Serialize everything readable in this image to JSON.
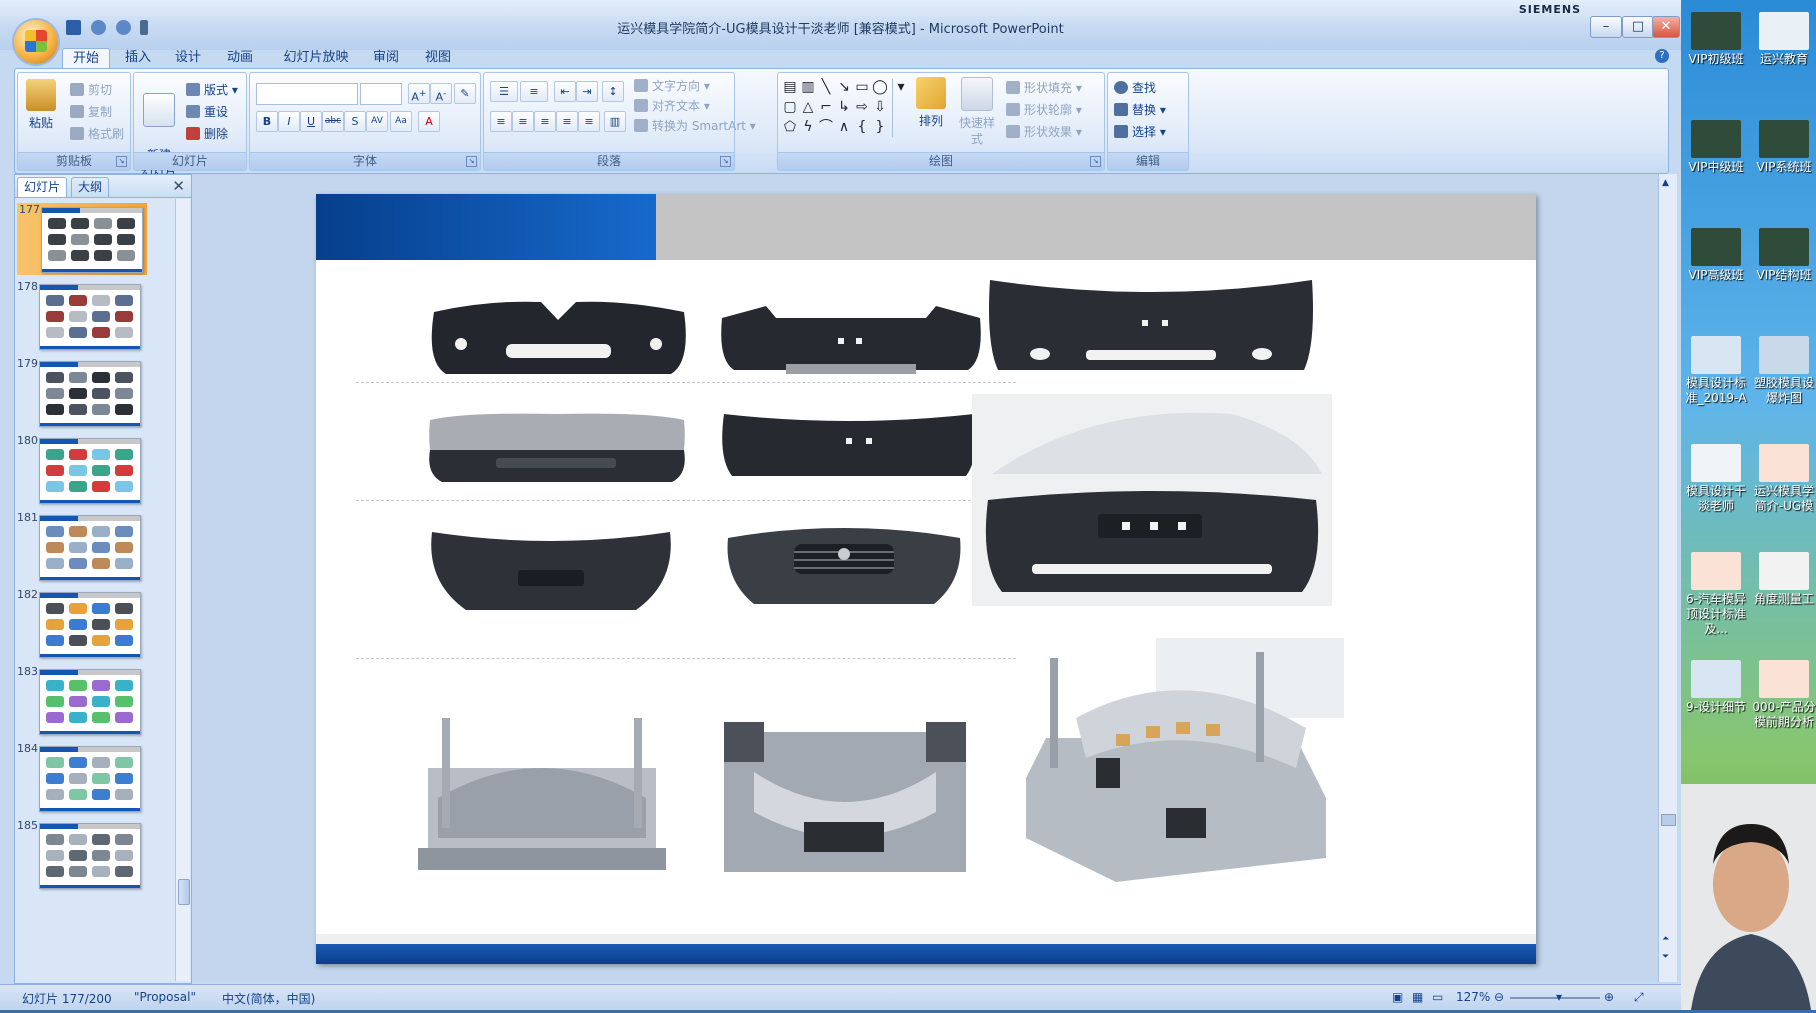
{
  "window": {
    "title": "运兴模具学院简介-UG模具设计干淡老师 [兼容模式] - Microsoft PowerPoint",
    "brand": "SIEMENS"
  },
  "tabs": [
    "开始",
    "插入",
    "设计",
    "动画",
    "幻灯片放映",
    "审阅",
    "视图"
  ],
  "ribbon": {
    "clipboard": {
      "label": "剪贴板",
      "paste": "粘贴",
      "cut": "剪切",
      "copy": "复制",
      "format_painter": "格式刷"
    },
    "slides": {
      "label": "幻灯片",
      "new_slide": "新建\n幻灯片",
      "layout": "版式",
      "reset": "重设",
      "delete": "删除"
    },
    "font": {
      "label": "字体"
    },
    "paragraph": {
      "label": "段落",
      "text_direction": "文字方向",
      "align_text": "对齐文本",
      "convert_smartart": "转换为 SmartArt"
    },
    "drawing": {
      "label": "绘图",
      "arrange": "排列",
      "quick_styles": "快速样式",
      "shape_fill": "形状填充",
      "shape_outline": "形状轮廓",
      "shape_effects": "形状效果"
    },
    "editing": {
      "label": "编辑",
      "find": "查找",
      "replace": "替换",
      "select": "选择"
    }
  },
  "panel": {
    "tab_slides": "幻灯片",
    "tab_outline": "大纲",
    "slides": [
      "177",
      "178",
      "179",
      "180",
      "181",
      "182",
      "183",
      "184",
      "185"
    ],
    "selected": "177"
  },
  "status": {
    "slide_pos": "幻灯片 177/200",
    "theme": "\"Proposal\"",
    "language": "中文(简体，中国)",
    "zoom": "127%"
  },
  "desktop_icons": [
    {
      "label": "VIP初级班"
    },
    {
      "label": "运兴教育"
    },
    {
      "label": "VIP中级班"
    },
    {
      "label": "VIP系统班"
    },
    {
      "label": "VIP高级班"
    },
    {
      "label": "VIP结构班"
    },
    {
      "label": "模具设计标准_2019-A"
    },
    {
      "label": "塑胶模具设爆炸图"
    },
    {
      "label": "模具设计干淡老师"
    },
    {
      "label": "运兴模具学简介-UG模"
    },
    {
      "label": "6-汽车模异顶设计标准及..."
    },
    {
      "label": "角度测量工"
    },
    {
      "label": "9-设计细节"
    },
    {
      "label": "000-产品分模前期分析"
    }
  ],
  "colors": {
    "ribbon_bg": "#dce8f8",
    "slide_blue": "#1357b3",
    "slide_grey": "#c3c3c3",
    "bumper_dark": "#2b2f35",
    "bumper_silver": "#a9adb3",
    "mold_metal": "#b6bcc4"
  }
}
